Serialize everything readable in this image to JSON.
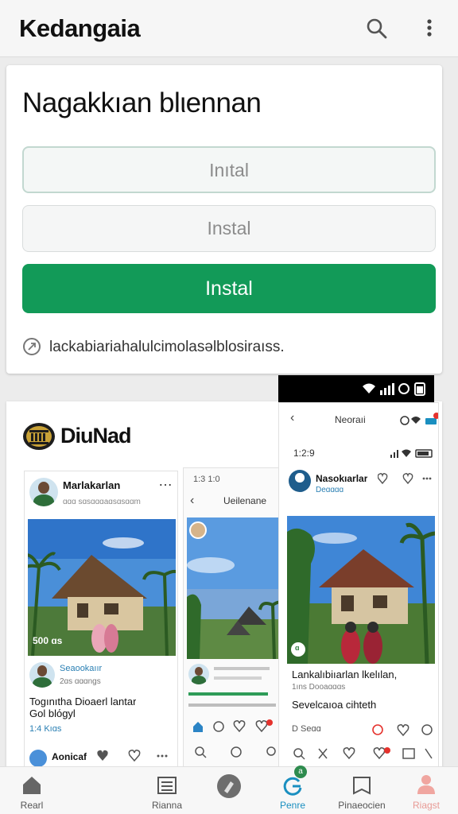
{
  "app_title": "Kedangaia",
  "header": {
    "icons": [
      "search-icon",
      "more-vert-icon"
    ]
  },
  "form": {
    "heading": "Nagakkıan blιennan",
    "field1_value": "Inıtal",
    "field2_value": "Instal",
    "button_label": "Instal",
    "hint_text": "lackabiariahalulcimolasəlblosiraıss."
  },
  "promo": {
    "brand_name": "DiuNad",
    "post1": {
      "user": "Marlakarlan",
      "handle": "ɑɑɑ sɑsɑɑɑaɑsɑsɑɑm",
      "photo_caption": "500 ɑs",
      "commenter": "Seaookaıır",
      "commenter_sub": "2ɑs ɑɑɑngs",
      "caption_line1": "Togınıtha Dioaerl lantar",
      "caption_line2": "Gol blόgyl",
      "stats": "1:4 Kıɑs",
      "footer_user": "Aonicaf"
    },
    "phone2": {
      "time": "1:3 1:0",
      "title": "Ueilenane"
    },
    "phone3": {
      "header_title": "Neoraıi",
      "time": "1:2:9",
      "user": "Nasokıarlar",
      "user_sub": "Deɑɑɑɑ",
      "photo_badge": "ɑ",
      "caption1": "Lankalıbiıarlan lkelılan,",
      "caption1_sub": "1ıns Dooaɑɑɑs",
      "caption2": "Sevelcaıoa cihteth",
      "reply": "D Seɑɑ"
    }
  },
  "bottom_nav": [
    {
      "label": "Rearl",
      "icon": "home-icon"
    },
    {
      "label": "Rianna",
      "icon": "list-icon"
    },
    {
      "label": "",
      "icon": "compose-icon"
    },
    {
      "label": "Penre",
      "icon": "refresh-icon",
      "badge": "a",
      "active": true
    },
    {
      "label": "Pinaeocien",
      "icon": "book-icon"
    },
    {
      "label": "Riagst",
      "icon": "profile-icon"
    }
  ],
  "colors": {
    "accent": "#129a58",
    "appbar": "#f6f6f6",
    "nav_active": "#1a8fc0"
  }
}
